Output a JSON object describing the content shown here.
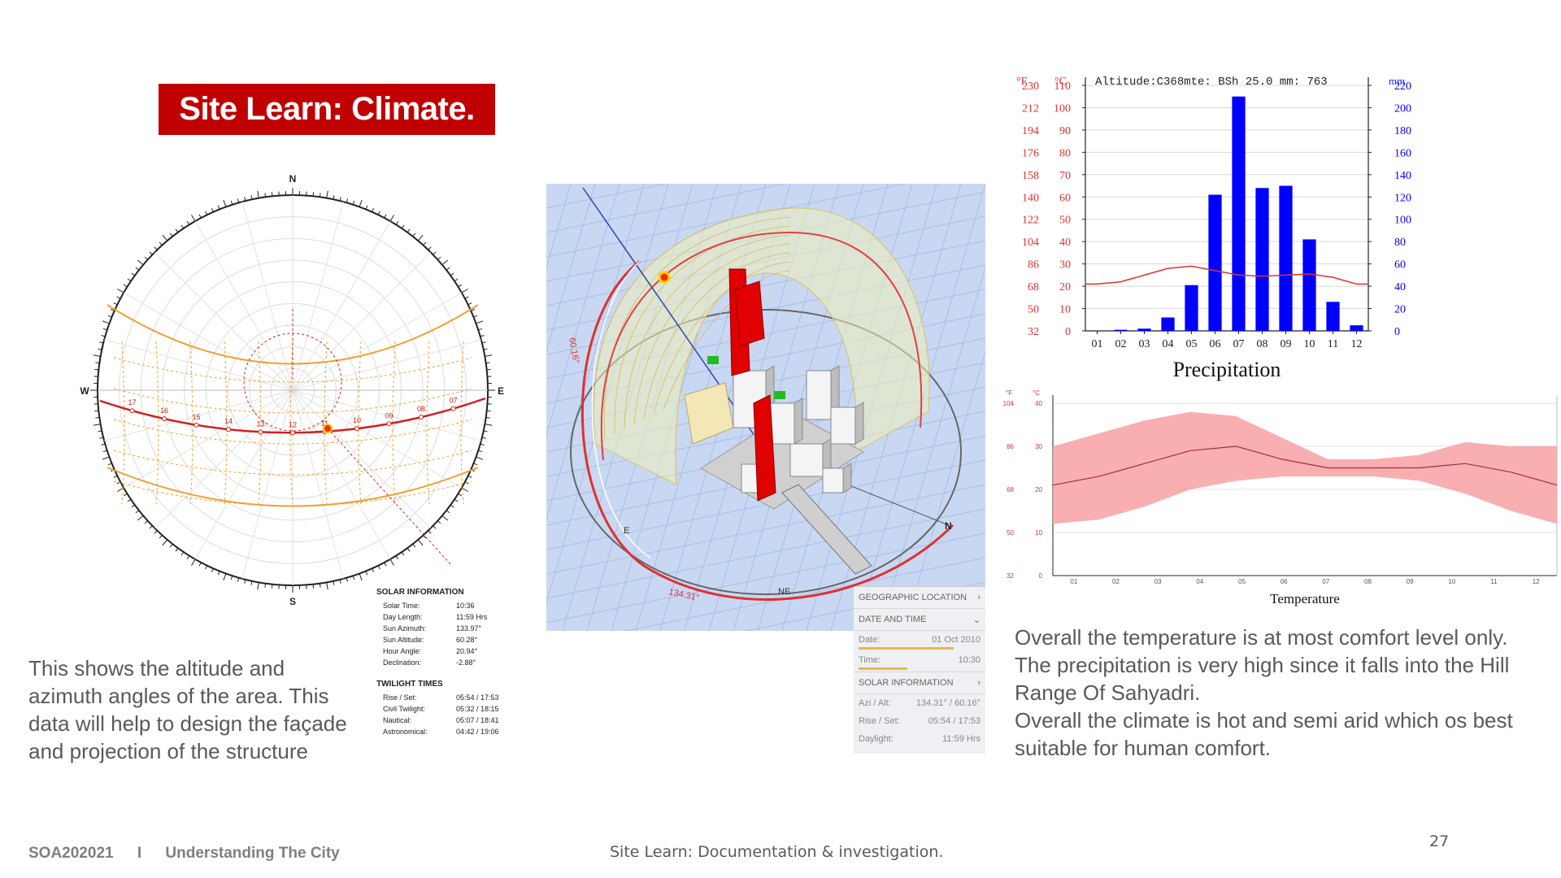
{
  "title": "Site Learn: Climate.",
  "left_caption": "This shows the altitude and azimuth angles of the area. This data will help to design the façade and projection of the structure",
  "right_caption_1": "Overall the temperature is at most comfort level only. The precipitation is very high since it falls into the Hill Range Of Sahyadri.",
  "right_caption_2": "Overall the climate is hot and semi arid  which os best suitable for human comfort.",
  "footer": {
    "course": "SOA202021",
    "separator": "I",
    "topic": "Understanding The City",
    "center": "Site Learn: Documentation & investigation.",
    "page": "27"
  },
  "sun_path": {
    "cardinals": [
      "N",
      "E",
      "S",
      "W"
    ],
    "hours": [
      "17",
      "16",
      "15",
      "14",
      "13",
      "12",
      "11",
      "10",
      "09",
      "08",
      "07"
    ],
    "solar_information_title": "SOLAR INFORMATION",
    "solar_information": [
      {
        "label": "Solar Time:",
        "value": "10:36"
      },
      {
        "label": "Day Length:",
        "value": "11:59 Hrs"
      },
      {
        "label": "Sun Azimuth:",
        "value": "133.97°"
      },
      {
        "label": "Sun Altitude:",
        "value": "60.28°"
      },
      {
        "label": "Hour Angle:",
        "value": "20.94°"
      },
      {
        "label": "Declination:",
        "value": "-2.88°"
      }
    ],
    "twilight_title": "TWILIGHT TIMES",
    "twilight": [
      {
        "label": "Rise / Set:",
        "value": "05:54 / 17:53"
      },
      {
        "label": "Civil Twilight:",
        "value": "05:32 / 18:15"
      },
      {
        "label": "Nautical:",
        "value": "05:07 / 18:41"
      },
      {
        "label": "Astronomical:",
        "value": "04:42 / 19:06"
      }
    ]
  },
  "model_panel": {
    "geo_location": "GEOGRAPHIC LOCATION",
    "date_and_time": "DATE AND TIME",
    "date_label": "Date:",
    "date_value": "01 Oct 2010",
    "time_label": "Time:",
    "time_value": "10:30",
    "solar_info": "SOLAR INFORMATION",
    "azi_label": "Azi / Alt:",
    "azi_value": "134.31° / 60.16°",
    "rise_label": "Rise / Set:",
    "rise_value": "05:54 / 17:53",
    "daylight_label": "Daylight:",
    "daylight_value": "11:59 Hrs",
    "compass": [
      "NE",
      "E",
      "N"
    ],
    "angle_label_1": "60.16°",
    "angle_label_2": "134.31°"
  },
  "colors": {
    "title_bg": "#c00000",
    "precip_bar": "#0000ff",
    "temp_line": "#e03030",
    "temp_band": "#f8a5a8",
    "sun_path_orange": "#f0a030",
    "sun_path_red": "#d02020"
  },
  "chart_data": [
    {
      "type": "bar",
      "title": "Precipitation",
      "header": "Altitude:C368mte: BSh 25.0 mm: 763",
      "categories": [
        "01",
        "02",
        "03",
        "04",
        "05",
        "06",
        "07",
        "08",
        "09",
        "10",
        "11",
        "12"
      ],
      "series": [
        {
          "values": [
            0,
            1,
            2,
            12,
            41,
            122,
            210,
            128,
            130,
            82,
            26,
            5
          ]
        }
      ],
      "line": {
        "values": [
          21,
          22,
          25,
          28,
          29,
          27,
          25,
          24.5,
          25,
          25.5,
          24,
          21
        ]
      },
      "left_axis_f": [
        "230",
        "212",
        "194",
        "176",
        "158",
        "140",
        "122",
        "104",
        "86",
        "68",
        "50",
        "32"
      ],
      "left_axis_c": [
        "110",
        "100",
        "90",
        "80",
        "70",
        "60",
        "50",
        "40",
        "30",
        "20",
        "10",
        "0"
      ],
      "right_axis_mm": [
        "220",
        "200",
        "180",
        "160",
        "140",
        "120",
        "100",
        "80",
        "60",
        "40",
        "20",
        "0"
      ],
      "unit_f": "°F",
      "unit_c": "°C",
      "unit_mm": "mm",
      "ylim_mm": [
        0,
        220
      ]
    },
    {
      "type": "area",
      "title": "Temperature",
      "categories": [
        "01",
        "02",
        "03",
        "04",
        "05",
        "06",
        "07",
        "08",
        "09",
        "10",
        "11",
        "12"
      ],
      "mean": [
        21,
        23,
        26,
        29,
        30,
        27,
        25,
        25,
        25,
        26,
        24,
        21
      ],
      "min": [
        12,
        13,
        16,
        20,
        22,
        23,
        23,
        23,
        22,
        19,
        15,
        12
      ],
      "max": [
        30,
        33,
        36,
        38,
        37,
        32,
        27,
        27,
        28,
        31,
        30,
        30
      ],
      "y_ticks_c": [
        "40",
        "30",
        "20",
        "10",
        "0"
      ],
      "y_ticks_f": [
        "104",
        "86",
        "68",
        "50",
        "32"
      ],
      "unit_f": "°F",
      "unit_c": "°C",
      "ylim": [
        0,
        40
      ]
    }
  ]
}
